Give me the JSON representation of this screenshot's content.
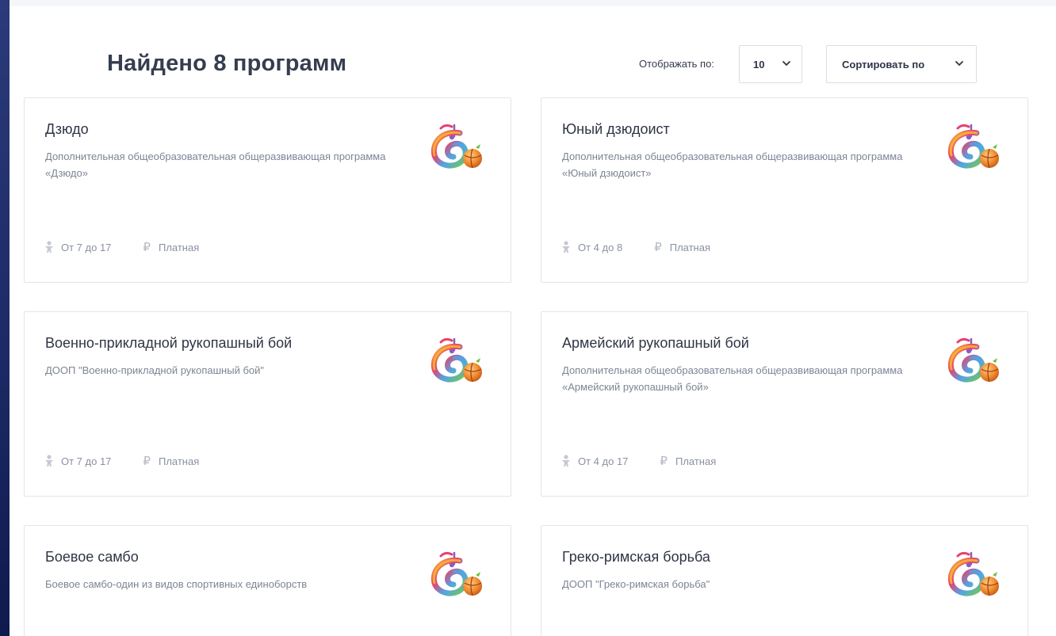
{
  "header": {
    "title": "Найдено 8 программ",
    "per_page_label": "Отображать по:",
    "per_page_value": "10",
    "sort_label": "Сортировать по"
  },
  "programs": [
    {
      "title": "Дзюдо",
      "description": "Дополнительная общеобразовательная общеразвивающая программа «Дзюдо»",
      "age": "От 7 до 17",
      "price": "Платная"
    },
    {
      "title": "Юный дзюдоист",
      "description": "Дополнительная общеобразовательная общеразвивающая программа «Юный дзюдоист»",
      "age": "От 4 до 8",
      "price": "Платная"
    },
    {
      "title": "Военно-прикладной рукопашный бой",
      "description": "ДООП \"Военно-прикладной рукопашный бой\"",
      "age": "От 7 до 17",
      "price": "Платная"
    },
    {
      "title": "Армейский рукопашный бой",
      "description": "Дополнительная общеобразовательная общеразвивающая программа «Армейский рукопашный бой»",
      "age": "От 4 до 17",
      "price": "Платная"
    },
    {
      "title": "Боевое самбо",
      "description": "Боевое самбо-один из видов спортивных единоборств",
      "age": "",
      "price": ""
    },
    {
      "title": "Греко-римская борьба",
      "description": "ДООП \"Греко-римская борьба\"",
      "age": "",
      "price": ""
    }
  ],
  "icons": {
    "chevron": "chevron-down-icon",
    "age": "child-icon",
    "price": "ruble-icon",
    "logo": "program-logo-icon"
  },
  "colors": {
    "sidebar": "#1c2a66",
    "title": "#353d4f",
    "muted": "#7d8494",
    "border": "#e3e5ea"
  }
}
